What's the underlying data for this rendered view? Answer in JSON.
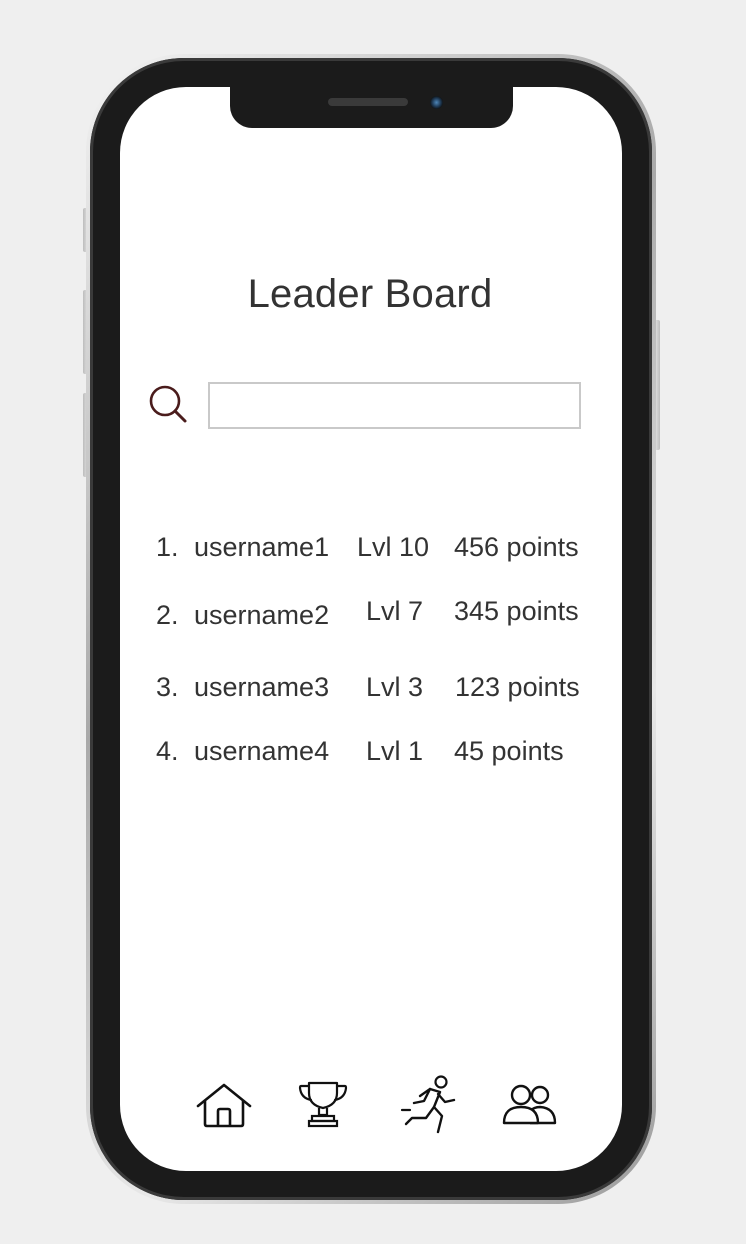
{
  "page": {
    "title": "Leader Board"
  },
  "search": {
    "placeholder": "",
    "value": ""
  },
  "leaderboard": [
    {
      "rank": "1.",
      "username": "username1",
      "level": "Lvl 10",
      "points": "456 points"
    },
    {
      "rank": "2.",
      "username": "username2",
      "level": "Lvl 7",
      "points": "345 points"
    },
    {
      "rank": "3.",
      "username": "username3",
      "level": "Lvl 3",
      "points": "123 points"
    },
    {
      "rank": "4.",
      "username": "username4",
      "level": "Lvl 1",
      "points": "45 points"
    }
  ],
  "bottom_nav": {
    "items": [
      {
        "icon": "home-icon"
      },
      {
        "icon": "trophy-icon"
      },
      {
        "icon": "running-person-icon"
      },
      {
        "icon": "friends-icon"
      }
    ]
  },
  "colors": {
    "text": "#333333",
    "search_icon": "#4a1c1c",
    "input_border": "#c9c9c9",
    "phone_body": "#1b1b1b",
    "background": "#efefef"
  }
}
